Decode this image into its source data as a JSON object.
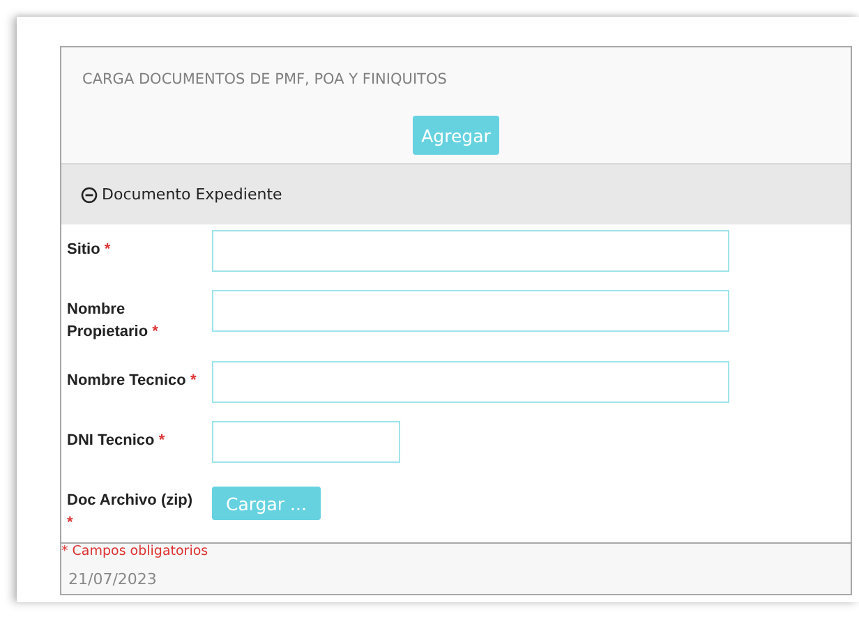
{
  "panel": {
    "title": "CARGA DOCUMENTOS DE PMF, POA Y FINIQUITOS",
    "add_button": "Agregar"
  },
  "section": {
    "title": "Documento Expediente",
    "expanded": true
  },
  "fields": [
    {
      "kind": "text",
      "label": "Sitio",
      "required_mark": "*"
    },
    {
      "kind": "text",
      "label": "Nombre Propietario",
      "required_mark": "*"
    },
    {
      "kind": "text",
      "label": "Nombre Tecnico",
      "required_mark": "*"
    },
    {
      "kind": "short_text",
      "label": "DNI Tecnico",
      "required_mark": "*"
    },
    {
      "kind": "upload",
      "label": "Doc Archivo (zip)",
      "required_mark": "*",
      "button": "Cargar ..."
    }
  ],
  "footer": {
    "required_note_mark": "*",
    "required_note": "Campos obligatorios",
    "date": "21/07/2023"
  }
}
